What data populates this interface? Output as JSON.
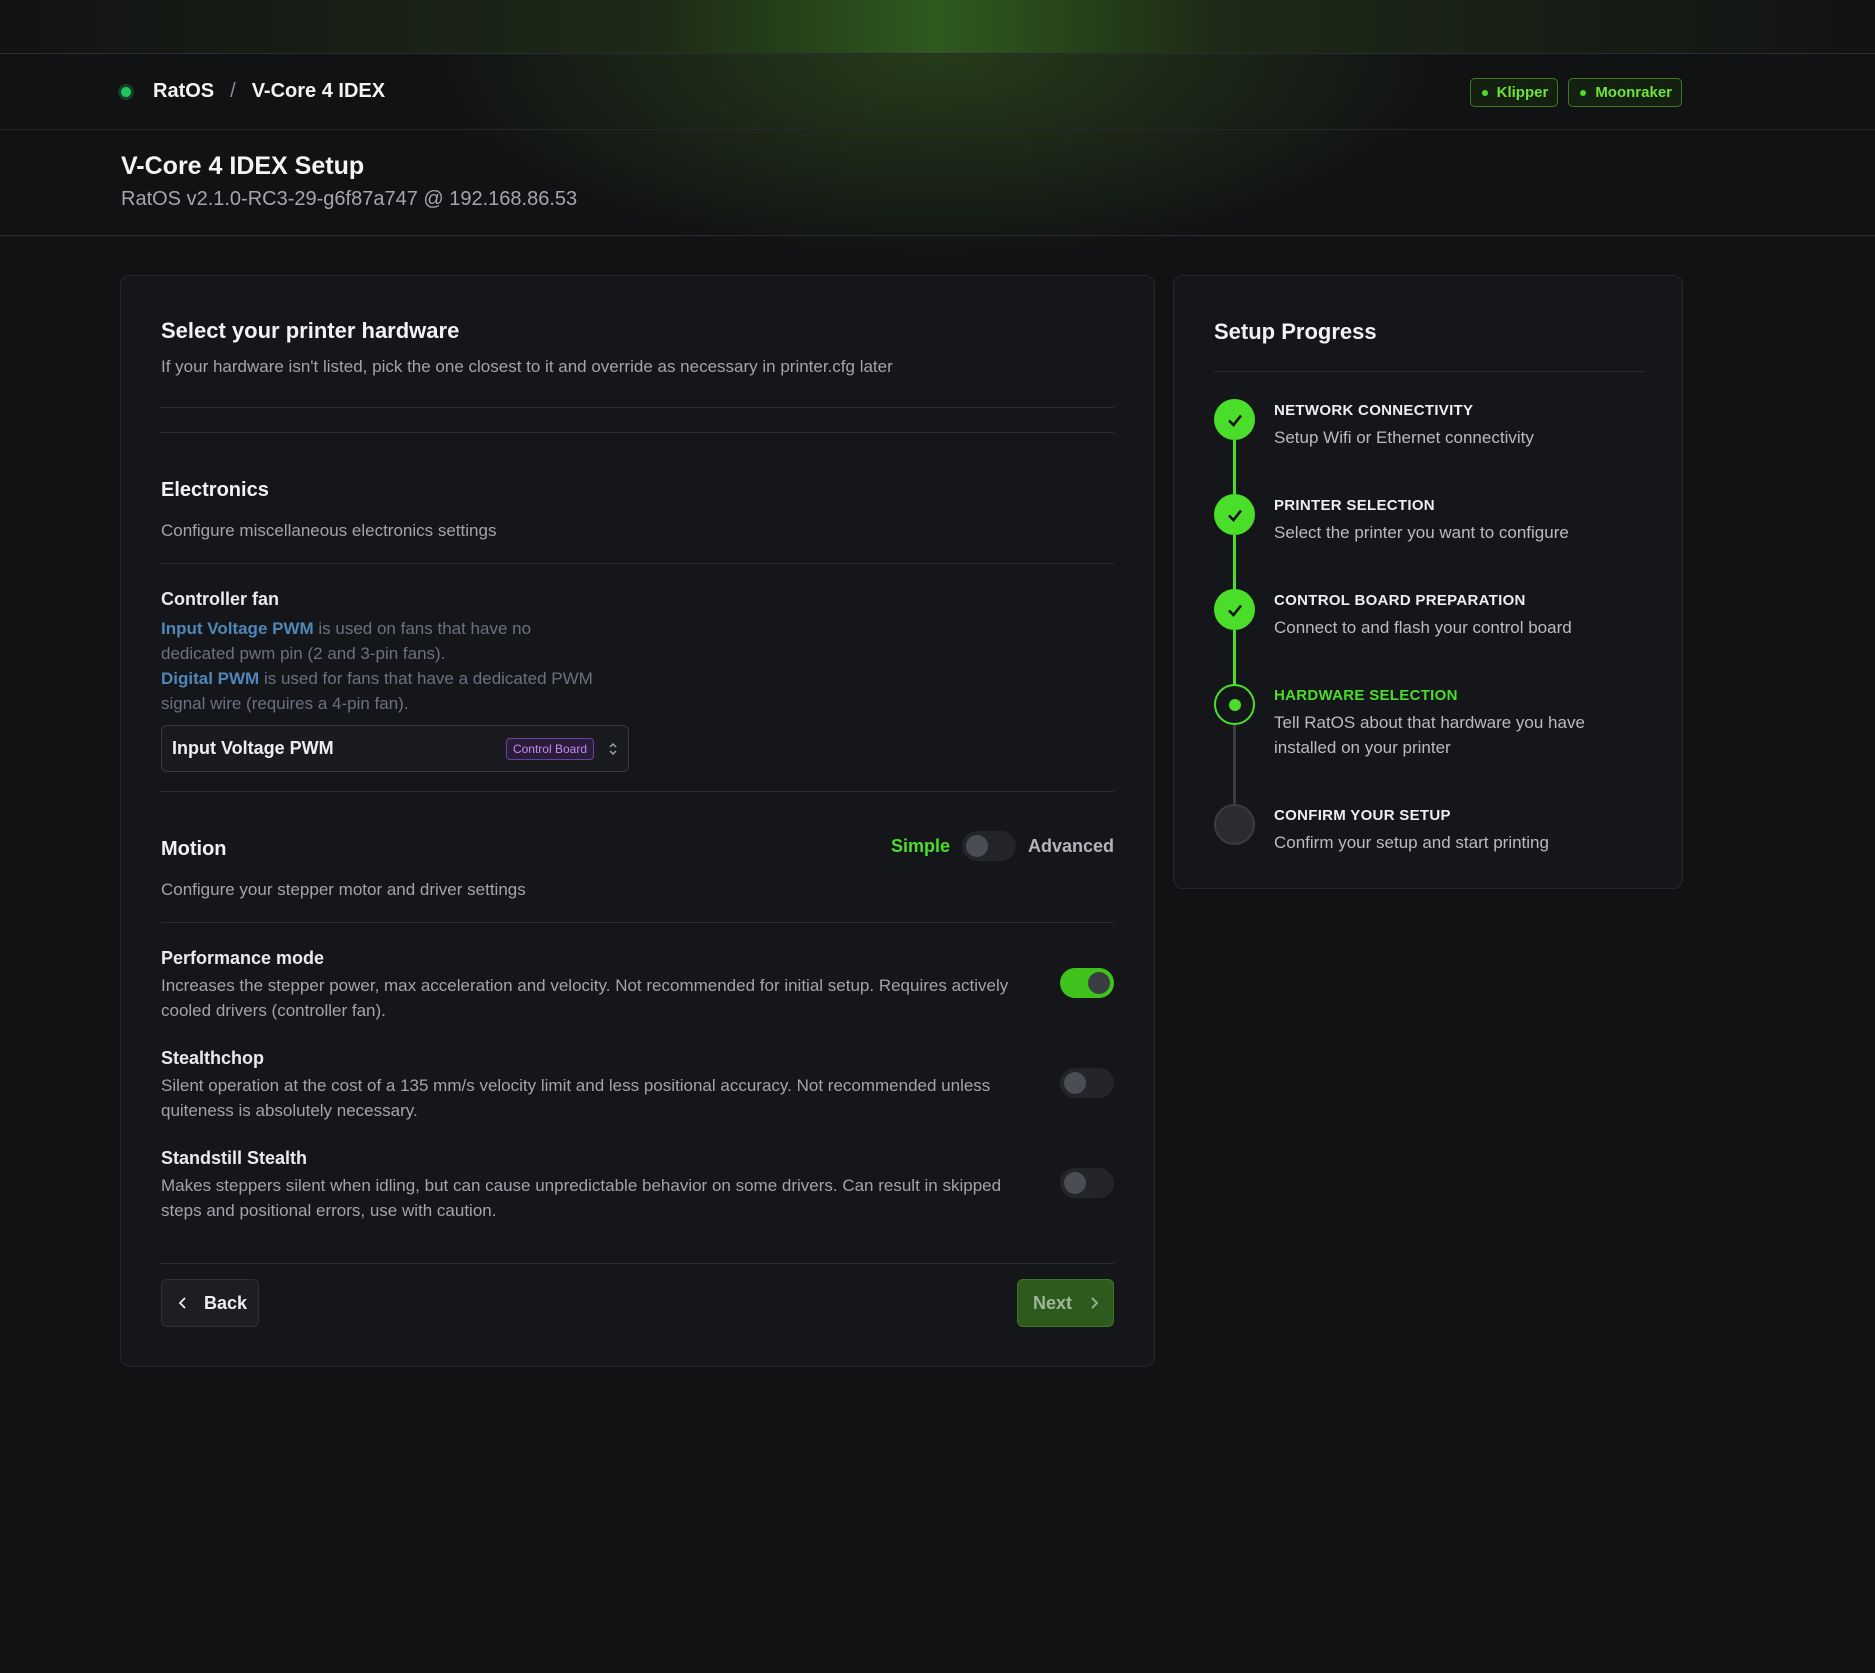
{
  "header": {
    "breadcrumb": [
      "RatOS",
      "V-Core 4 IDEX"
    ],
    "breadcrumb_separator": "/",
    "status_badges": [
      "Klipper",
      "Moonraker"
    ],
    "page_title": "V-Core 4 IDEX Setup",
    "page_subtitle": "RatOS v2.1.0-RC3-29-g6f87a747 @ 192.168.86.53"
  },
  "main": {
    "title": "Select your printer hardware",
    "description": "If your hardware isn't listed, pick the one closest to it and override as necessary in printer.cfg later",
    "electronics": {
      "title": "Electronics",
      "description": "Configure miscellaneous electronics settings",
      "controller_fan": {
        "label": "Controller fan",
        "help_hl_1": "Input Voltage PWM",
        "help_text_1": " is used on fans that have no dedicated pwm pin (2 and 3-pin fans).",
        "help_hl_2": "Digital PWM",
        "help_text_2": " is used for fans that have a dedicated PWM signal wire (requires a 4-pin fan).",
        "selected": "Input Voltage PWM",
        "selected_badge": "Control Board"
      }
    },
    "motion": {
      "title": "Motion",
      "description": "Configure your stepper motor and driver settings",
      "mode_simple": "Simple",
      "mode_advanced": "Advanced",
      "mode_is_advanced": false,
      "options": [
        {
          "title": "Performance mode",
          "description": "Increases the stepper power, max acceleration and velocity. Not recommended for initial setup. Requires actively cooled drivers (controller fan).",
          "enabled": true
        },
        {
          "title": "Stealthchop",
          "description": "Silent operation at the cost of a 135 mm/s velocity limit and less positional accuracy. Not recommended unless quiteness is absolutely necessary.",
          "enabled": false
        },
        {
          "title": "Standstill Stealth",
          "description": "Makes steppers silent when idling, but can cause unpredictable behavior on some drivers. Can result in skipped steps and positional errors, use with caution.",
          "enabled": false
        }
      ]
    },
    "buttons": {
      "back": "Back",
      "next": "Next"
    }
  },
  "progress": {
    "title": "Setup Progress",
    "steps": [
      {
        "title": "NETWORK CONNECTIVITY",
        "description": "Setup Wifi or Ethernet connectivity",
        "status": "done"
      },
      {
        "title": "PRINTER SELECTION",
        "description": "Select the printer you want to configure",
        "status": "done"
      },
      {
        "title": "CONTROL BOARD PREPARATION",
        "description": "Connect to and flash your control board",
        "status": "done"
      },
      {
        "title": "HARDWARE SELECTION",
        "description": "Tell RatOS about that hardware you have installed on your printer",
        "status": "current"
      },
      {
        "title": "CONFIRM YOUR SETUP",
        "description": "Confirm your setup and start printing",
        "status": "todo"
      }
    ]
  },
  "colors": {
    "accent": "#4ade2a",
    "background": "#111214",
    "card": "#15161a",
    "link_blue": "#4f87b8",
    "badge_purple": "#c58af0"
  }
}
